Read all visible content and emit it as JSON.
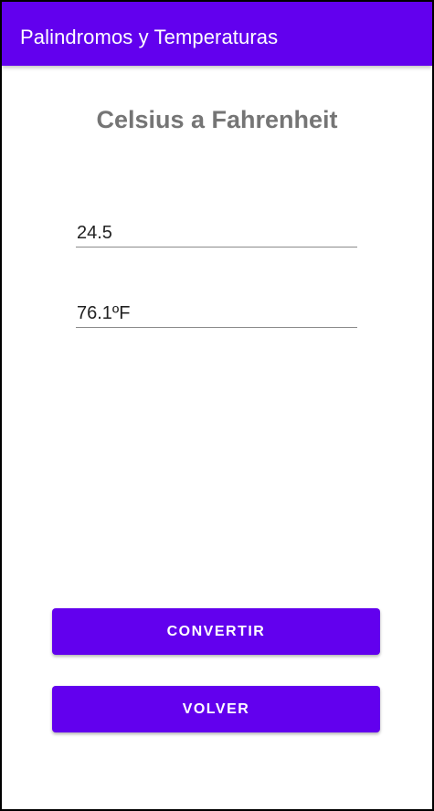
{
  "app_bar": {
    "title": "Palindromos y Temperaturas",
    "color": "#6200ee"
  },
  "screen": {
    "heading": "Celsius a Fahrenheit"
  },
  "celsius_input": {
    "value": "24.5",
    "placeholder": ""
  },
  "fahrenheit_output": {
    "value": "76.1ºF",
    "placeholder": ""
  },
  "buttons": {
    "convert_label": "CONVERTIR",
    "back_label": "VOLVER",
    "color": "#6200ee"
  }
}
